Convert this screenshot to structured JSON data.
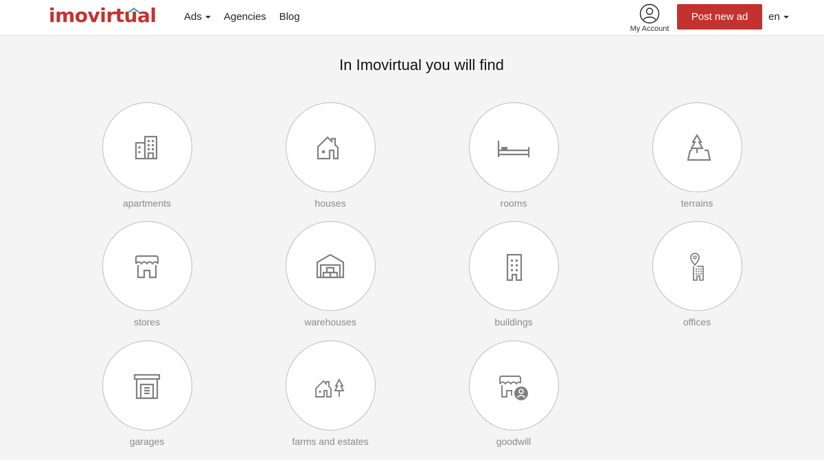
{
  "header": {
    "logo": "imovirtual",
    "nav": [
      {
        "label": "Ads",
        "has_dropdown": true
      },
      {
        "label": "Agencies",
        "has_dropdown": false
      },
      {
        "label": "Blog",
        "has_dropdown": false
      }
    ],
    "account_label": "My Account",
    "post_button": "Post new ad",
    "language": "en",
    "brand_color": "#c4322f"
  },
  "main": {
    "title": "In Imovirtual you will find",
    "categories": [
      {
        "label": "apartments",
        "icon": "apartments-icon"
      },
      {
        "label": "houses",
        "icon": "house-icon"
      },
      {
        "label": "rooms",
        "icon": "bed-icon"
      },
      {
        "label": "terrains",
        "icon": "terrain-icon"
      },
      {
        "label": "stores",
        "icon": "store-icon"
      },
      {
        "label": "warehouses",
        "icon": "warehouse-icon"
      },
      {
        "label": "buildings",
        "icon": "building-icon"
      },
      {
        "label": "offices",
        "icon": "office-icon"
      },
      {
        "label": "garages",
        "icon": "garage-icon"
      },
      {
        "label": "farms and estates",
        "icon": "farm-icon"
      },
      {
        "label": "goodwill",
        "icon": "goodwill-icon"
      }
    ]
  }
}
